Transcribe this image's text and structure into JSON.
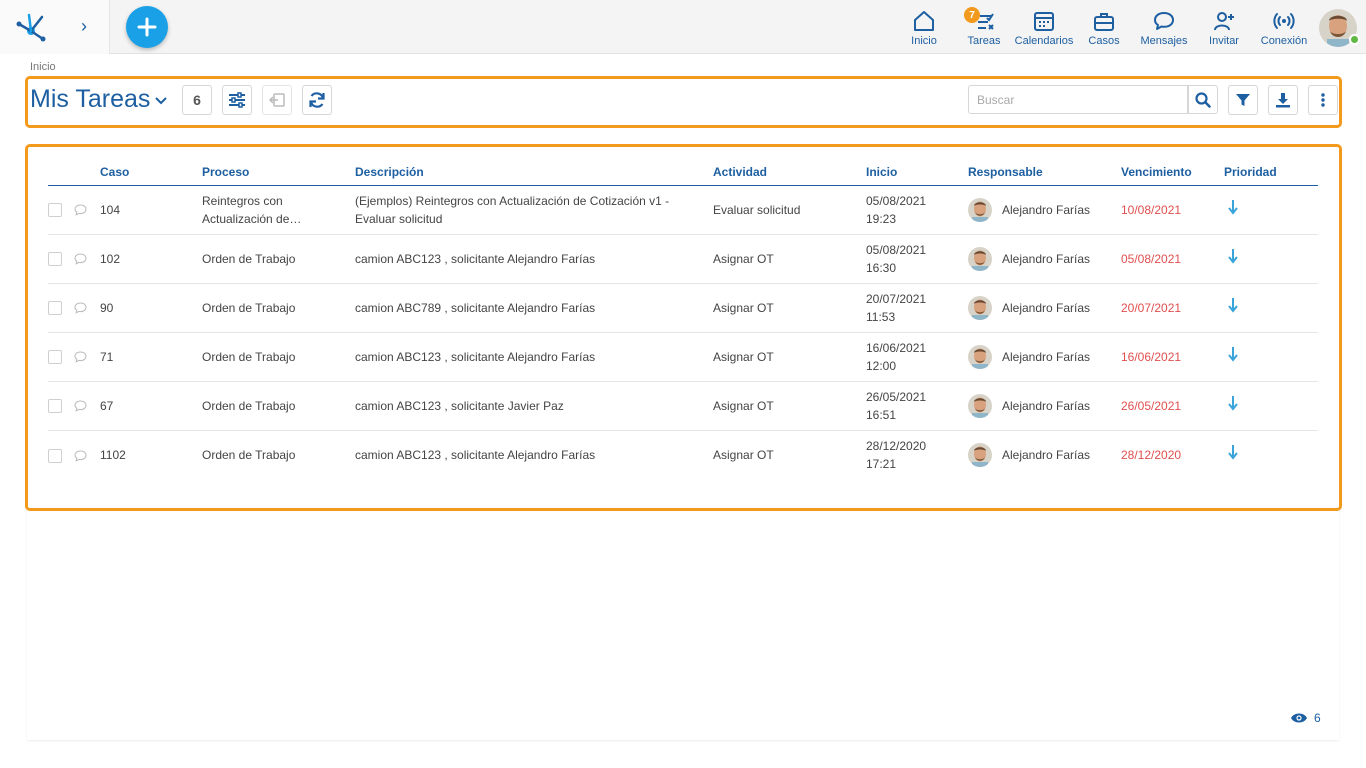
{
  "breadcrumb": "Inicio",
  "nav": {
    "inicio": "Inicio",
    "tareas": "Tareas",
    "tareas_badge": "7",
    "calendarios": "Calendarios",
    "casos": "Casos",
    "mensajes": "Mensajes",
    "invitar": "Invitar",
    "conexion": "Conexión"
  },
  "toolbar": {
    "title": "Mis Tareas",
    "count": "6",
    "search_placeholder": "Buscar"
  },
  "table": {
    "headers": {
      "caso": "Caso",
      "proceso": "Proceso",
      "descripcion": "Descripción",
      "actividad": "Actividad",
      "inicio": "Inicio",
      "responsable": "Responsable",
      "vencimiento": "Vencimiento",
      "prioridad": "Prioridad"
    },
    "rows": [
      {
        "caso": "104",
        "proceso": "Reintegros con Actualización de…",
        "descripcion": "(Ejemplos) Reintegros con Actualización de Cotización v1 - Evaluar solicitud",
        "actividad": "Evaluar solicitud",
        "inicio_fecha": "05/08/2021",
        "inicio_hora": "19:23",
        "responsable": "Alejandro Farías",
        "vencimiento": "10/08/2021"
      },
      {
        "caso": "102",
        "proceso": "Orden de Trabajo",
        "descripcion": "camion ABC123 , solicitante Alejandro Farías",
        "actividad": "Asignar OT",
        "inicio_fecha": "05/08/2021",
        "inicio_hora": "16:30",
        "responsable": "Alejandro Farías",
        "vencimiento": "05/08/2021"
      },
      {
        "caso": "90",
        "proceso": "Orden de Trabajo",
        "descripcion": "camion ABC789 , solicitante Alejandro Farías",
        "actividad": "Asignar OT",
        "inicio_fecha": "20/07/2021",
        "inicio_hora": "11:53",
        "responsable": "Alejandro Farías",
        "vencimiento": "20/07/2021"
      },
      {
        "caso": "71",
        "proceso": "Orden de Trabajo",
        "descripcion": "camion ABC123 , solicitante Alejandro Farías",
        "actividad": "Asignar OT",
        "inicio_fecha": "16/06/2021",
        "inicio_hora": "12:00",
        "responsable": "Alejandro Farías",
        "vencimiento": "16/06/2021"
      },
      {
        "caso": "67",
        "proceso": "Orden de Trabajo",
        "descripcion": "camion ABC123 , solicitante Javier Paz",
        "actividad": "Asignar OT",
        "inicio_fecha": "26/05/2021",
        "inicio_hora": "16:51",
        "responsable": "Alejandro Farías",
        "vencimiento": "26/05/2021"
      },
      {
        "caso": "1102",
        "proceso": "Orden de Trabajo",
        "descripcion": "camion ABC123 , solicitante Alejandro Farías",
        "actividad": "Asignar OT",
        "inicio_fecha": "28/12/2020",
        "inicio_hora": "17:21",
        "responsable": "Alejandro Farías",
        "vencimiento": "28/12/2020"
      }
    ]
  },
  "footer": {
    "views": "6"
  },
  "colors": {
    "brand": "#1d5fa1",
    "accent": "#1aa0e6",
    "highlight": "#f39a1c",
    "overdue": "#e14f4f"
  }
}
